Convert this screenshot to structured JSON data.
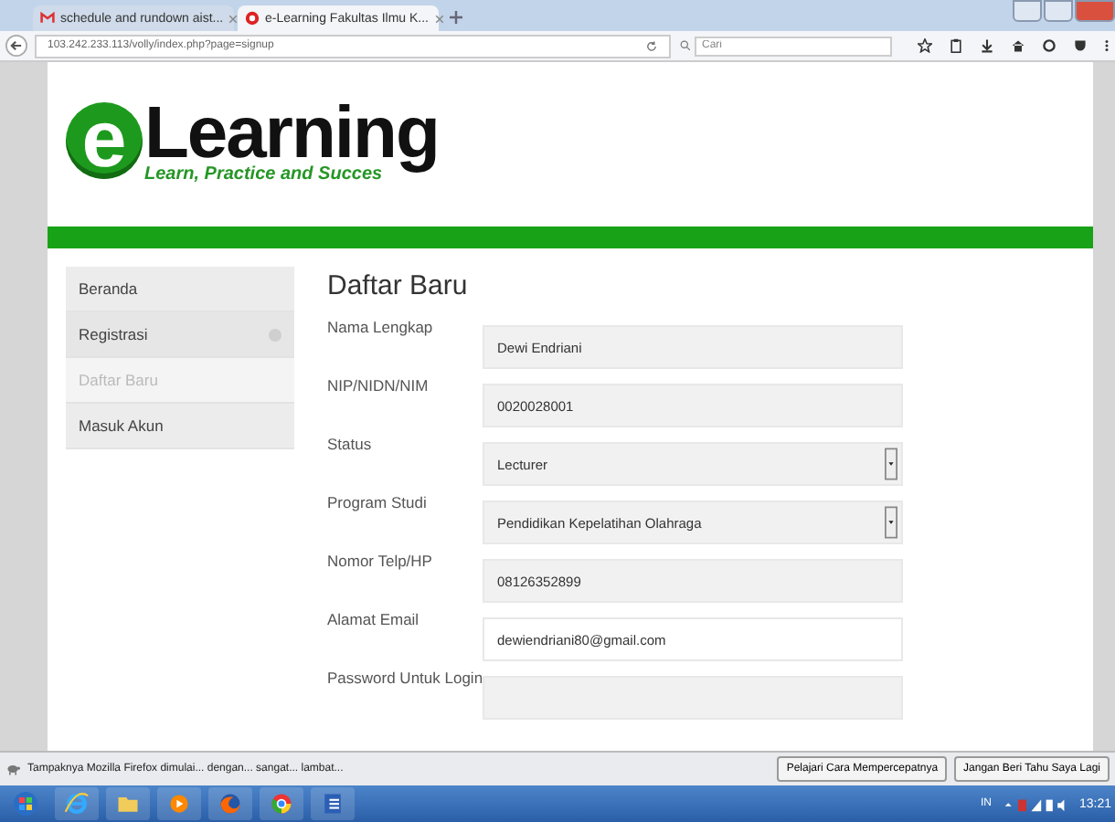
{
  "browser": {
    "tabs": [
      {
        "title": "schedule and rundown aist...",
        "selected": false
      },
      {
        "title": "e-Learning Fakultas Ilmu K...",
        "selected": true
      }
    ],
    "url": "103.242.233.113/volly/index.php?page=signup",
    "search": {
      "placeholder": "Cari"
    }
  },
  "header": {
    "logo_letter": "e",
    "logo_word": "Learning",
    "tagline": "Learn, Practice and Succes"
  },
  "sidebar": {
    "items": [
      {
        "label": "Beranda",
        "selected": false
      },
      {
        "label": "Registrasi",
        "selected": false,
        "expanded": true,
        "children": [
          {
            "label": "Daftar Baru",
            "selected": true
          }
        ]
      },
      {
        "label": "Masuk Akun",
        "selected": false
      }
    ]
  },
  "form": {
    "title": "Daftar Baru",
    "fields": [
      {
        "label": "Nama Lengkap",
        "kind": "text",
        "value": "Dewi Endriani",
        "readonly": true
      },
      {
        "label": "NIP/NIDN/NIM",
        "kind": "text",
        "value": "0020028001",
        "readonly": true
      },
      {
        "label": "Status",
        "kind": "select",
        "value": "Lecturer",
        "readonly": true
      },
      {
        "label": "Program Studi",
        "kind": "select",
        "value": "Pendidikan Kepelatihan Olahraga",
        "readonly": true
      },
      {
        "label": "Nomor Telp/HP",
        "kind": "text",
        "value": "08126352899",
        "readonly": true
      },
      {
        "label": "Alamat Email",
        "kind": "text",
        "value": "dewiendriani80@gmail.com",
        "readonly": false
      },
      {
        "label": "Password Untuk Login",
        "kind": "text",
        "readonly": true
      }
    ]
  },
  "notification": {
    "message": "Tampaknya Mozilla Firefox dimulai... dengan... sangat... lambat...",
    "buttons": [
      "Pelajari Cara Mempercepatnya",
      "Jangan Beri Tahu Saya Lagi"
    ]
  },
  "taskbar": {
    "language": "IN",
    "time": "13:21"
  }
}
